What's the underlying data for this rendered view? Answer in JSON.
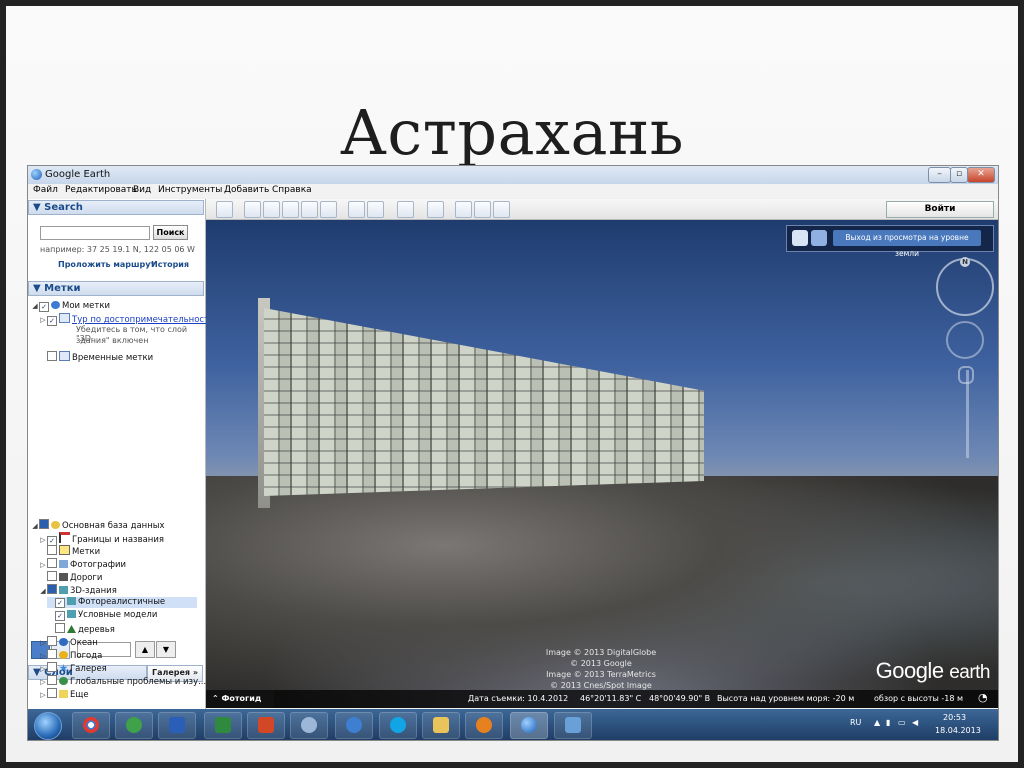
{
  "slide": {
    "title": "Астрахань"
  },
  "window": {
    "title": "Google Earth",
    "controls": {
      "minimize": "–",
      "maximize": "▫",
      "close": "✕"
    }
  },
  "menu": [
    "Файл",
    "Редактировать",
    "Вид",
    "Инструменты",
    "Добавить",
    "Справка"
  ],
  "search": {
    "header": "▼ Search",
    "button": "Поиск",
    "example": "например: 37 25 19.1 N, 122 05 06 W",
    "route_link": "Проложить маршрут",
    "history_link": "История"
  },
  "places": {
    "header": "▼ Метки",
    "my_places": "Мои метки",
    "tour": "Тур по достопримечательностям",
    "tour_note_1": "Убедитесь в том, что слой \"3D-",
    "tour_note_2": "здания\" включен",
    "temp": "Временные метки"
  },
  "layers": {
    "header": "▼ Слои",
    "gallery_button": "Галерея »",
    "items": [
      {
        "label": "Основная база данных"
      },
      {
        "label": "Границы и названия"
      },
      {
        "label": "Метки"
      },
      {
        "label": "Фотографии"
      },
      {
        "label": "Дороги"
      },
      {
        "label": "3D-здания"
      },
      {
        "label": "Фотореалистичные"
      },
      {
        "label": "Условные модели"
      },
      {
        "label": "деревья"
      },
      {
        "label": "Океан"
      },
      {
        "label": "Погода"
      },
      {
        "label": "Галерея"
      },
      {
        "label": "Глобальные проблемы и изу..."
      },
      {
        "label": "Еще"
      }
    ]
  },
  "toolbar": {
    "login": "Войти"
  },
  "view": {
    "exit_ground": "Выход из просмотра на уровне земли",
    "compass_n": "N",
    "credits": [
      "Image © 2013 DigitalGlobe",
      "© 2013 Google",
      "Image © 2013 TerraMetrics",
      "© 2013 Cnes/Spot Image"
    ],
    "brand_google": "Google",
    "brand_earth": "earth"
  },
  "status": {
    "tour_guide": "⌃ Фотогид",
    "date": "Дата съемки: 10.4.2012",
    "lat": "46°20'11.83\" С",
    "lon": "48°00'49.90\" В",
    "elev": "Высота над уровнем моря:  -20 м",
    "eye": "обзор с высоты   -18 м"
  },
  "taskbar": {
    "lang": "RU",
    "time": "20:53",
    "date": "18.04.2013"
  }
}
